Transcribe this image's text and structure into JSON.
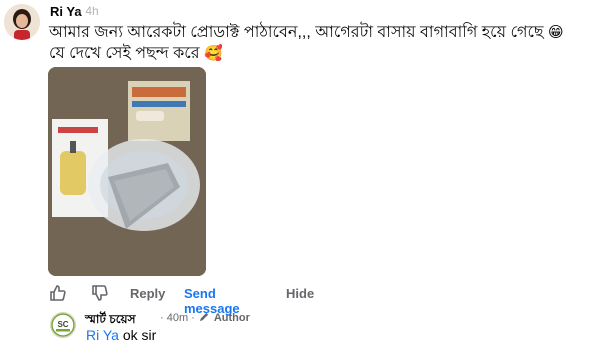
{
  "comment": {
    "author": "Ri Ya",
    "time": "· 4h",
    "line1": "আমার জন্য আরেকটা প্রোডাক্ট পাঠাবেন,,, আগেরটা বাসায় বাগাবাগি হয়ে গেছে",
    "line1_emoji": "😁",
    "line2": "যে দেখে সেই পছন্দ করে",
    "line2_emoji": "🥰",
    "image_alt": "Product photo: oil sprayer bottle box, plastic bowl, and metal mesh items"
  },
  "actions": {
    "like_icon": "thumbs-up-icon",
    "dislike_icon": "thumbs-down-icon",
    "reply": "Reply",
    "send_message": "Send message",
    "hide": "Hide"
  },
  "reply": {
    "author": "স্মার্ট চয়েস",
    "time": "· 40m ·",
    "author_badge": "Author",
    "badge_icon": "pencil-icon",
    "mention": "Ri Ya",
    "text": "ok sir"
  },
  "colors": {
    "link_blue": "#1877f2",
    "meta_gray": "#65676b"
  }
}
